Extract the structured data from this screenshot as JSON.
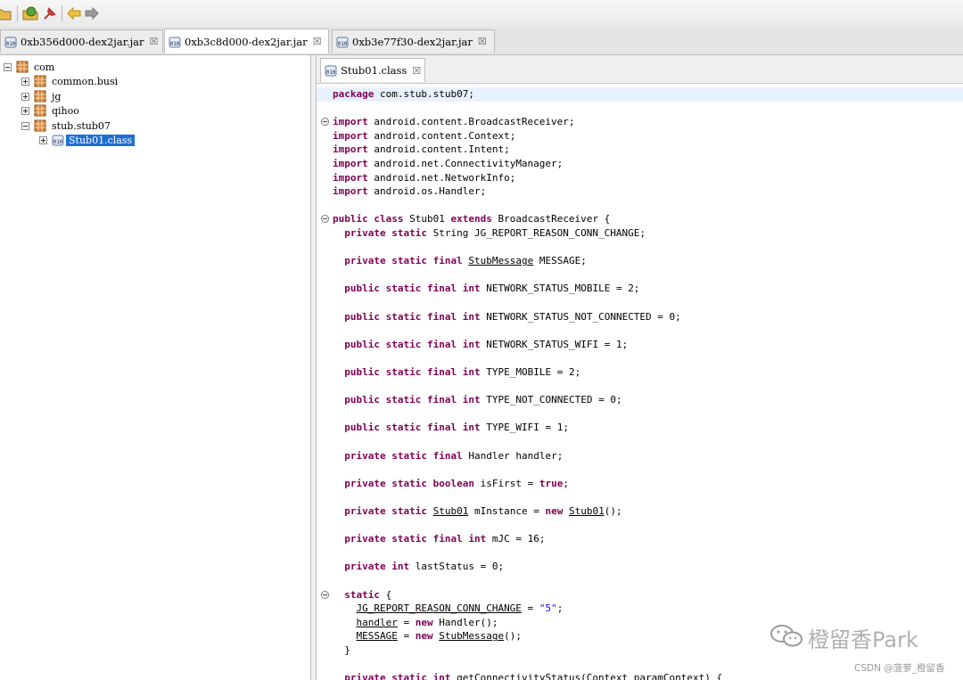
{
  "toolbar": {
    "buttons": [
      "open-folder-icon",
      "open-archive-icon",
      "pin-icon",
      "back-arrow-icon",
      "forward-arrow-icon"
    ]
  },
  "jar_tabs": [
    {
      "label": "0xb356d000-dex2jar.jar",
      "close": "☒"
    },
    {
      "label": "0xb3c8d000-dex2jar.jar",
      "close": "☒"
    },
    {
      "label": "0xb3e77f30-dex2jar.jar",
      "close": "☒"
    }
  ],
  "tree": {
    "root": "com",
    "children": [
      "common.busi",
      "jg",
      "qihoo",
      "stub.stub07"
    ],
    "selected": "Stub01.class"
  },
  "editor_tab": {
    "label": "Stub01.class",
    "close": "☒"
  },
  "code_lines": [
    "package com.stub.stub07;",
    "",
    "import android.content.BroadcastReceiver;",
    "import android.content.Context;",
    "import android.content.Intent;",
    "import android.net.ConnectivityManager;",
    "import android.net.NetworkInfo;",
    "import android.os.Handler;",
    "",
    "public class Stub01 extends BroadcastReceiver {",
    "  private static String JG_REPORT_REASON_CONN_CHANGE;",
    "",
    "  private static final StubMessage MESSAGE;",
    "",
    "  public static final int NETWORK_STATUS_MOBILE = 2;",
    "",
    "  public static final int NETWORK_STATUS_NOT_CONNECTED = 0;",
    "",
    "  public static final int NETWORK_STATUS_WIFI = 1;",
    "",
    "  public static final int TYPE_MOBILE = 2;",
    "",
    "  public static final int TYPE_NOT_CONNECTED = 0;",
    "",
    "  public static final int TYPE_WIFI = 1;",
    "",
    "  private static final Handler handler;",
    "",
    "  private static boolean isFirst = true;",
    "",
    "  private static Stub01 mInstance = new Stub01();",
    "",
    "  private static final int mJC = 16;",
    "",
    "  private int lastStatus = 0;",
    "",
    "  static {",
    "    JG_REPORT_REASON_CONN_CHANGE = \"5\";",
    "    handler = new Handler();",
    "    MESSAGE = new StubMessage();",
    "  }",
    "",
    "  private static int getConnectivityStatus(Context paramContext) {"
  ],
  "watermark": {
    "brand": "橙留香Park",
    "csdn": "CSDN @菠萝_橙留香"
  }
}
